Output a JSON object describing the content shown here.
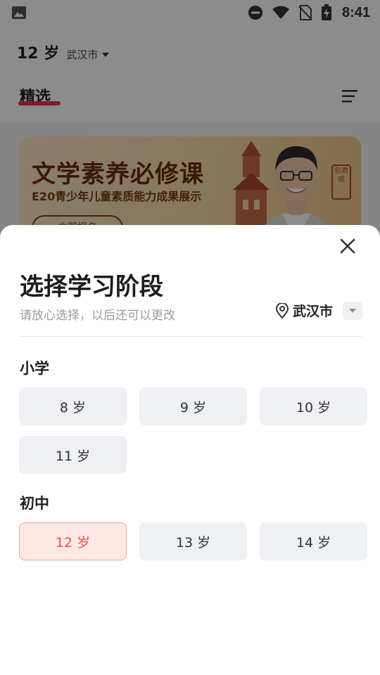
{
  "status_bar": {
    "time": "8:41",
    "icons": [
      "image-icon",
      "do-not-disturb-icon",
      "wifi-icon",
      "no-sim-icon",
      "battery-charging-icon"
    ]
  },
  "header": {
    "age": "12 岁",
    "city": "武汉市",
    "tab": "精选"
  },
  "banner": {
    "title": "文学素养必修课",
    "subtitle": "E20青少年儿童素质能力成果展示",
    "button": "立即报名",
    "seal": "包君成"
  },
  "sheet": {
    "title": "选择学习阶段",
    "subtitle": "请放心选择，以后还可以更改",
    "city": "武汉市",
    "sections": [
      {
        "label": "小学",
        "options": [
          "8 岁",
          "9 岁",
          "10 岁",
          "11 岁"
        ]
      },
      {
        "label": "初中",
        "options": [
          "12 岁",
          "13 岁",
          "14 岁"
        ]
      }
    ],
    "selected": "12 岁"
  },
  "colors": {
    "accent": "#ee5343",
    "selected_bg": "#fde8e6",
    "chip_bg": "#eef0f4",
    "underline": "#e5334a"
  }
}
